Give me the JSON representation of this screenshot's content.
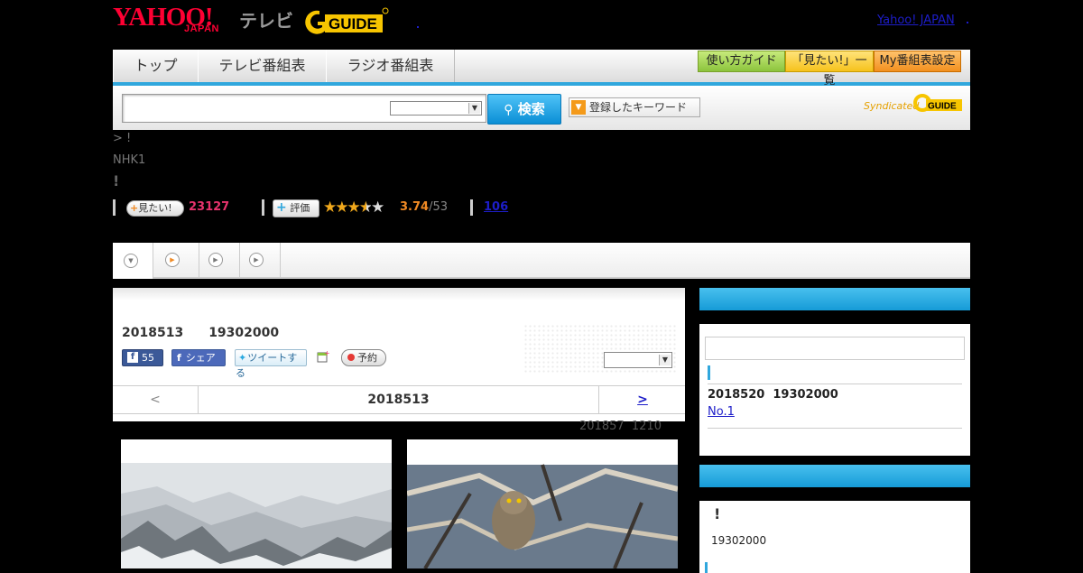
{
  "header": {
    "logo_yahoo": "YAHOO!",
    "logo_japan": "JAPAN",
    "logo_tv": "テレビ",
    "logo_gguide": "GUIDE",
    "yahoo_japan_link": "Yahoo! JAPAN"
  },
  "nav": {
    "tabs": [
      "トップ",
      "テレビ番組表",
      "ラジオ番組表"
    ],
    "guide_buttons": [
      "使い方ガイド",
      "「見たい!」一覧",
      "My番組表設定"
    ]
  },
  "search": {
    "button_label": "検索",
    "keyword_button_label": "登録したキーワード",
    "syndicated_label": "Syndicated",
    "syndicated_logo": "GUIDE"
  },
  "program": {
    "breadcrumb": "> !",
    "channel": "NHK1",
    "title": "!",
    "want_label": "見たい!",
    "want_count": "23127",
    "rating_label": "評価",
    "rating_value": "3.74",
    "rating_count": "/53",
    "rating_stars": 3.74,
    "review_link": "106"
  },
  "main": {
    "air_datetime": "2018513　　19302000",
    "fb_like_count": "55",
    "fb_share_label": "シェア",
    "tweet_label": "ツイートする",
    "reserve_label": "予約",
    "pager_prev": "<",
    "pager_date": "2018513",
    "pager_next": ">",
    "updated": "201857  1210"
  },
  "sidebar": {
    "next_air": "2018520  19302000",
    "rank_link": "No.1",
    "box2_title": "!",
    "box2_time": "19302000"
  },
  "colors": {
    "accent_blue": "#30a7dd",
    "yahoo_red": "#ff0033",
    "want_count_red": "#e8336d",
    "rating_orange": "#f08a24",
    "link_blue": "#1d1dc9"
  }
}
